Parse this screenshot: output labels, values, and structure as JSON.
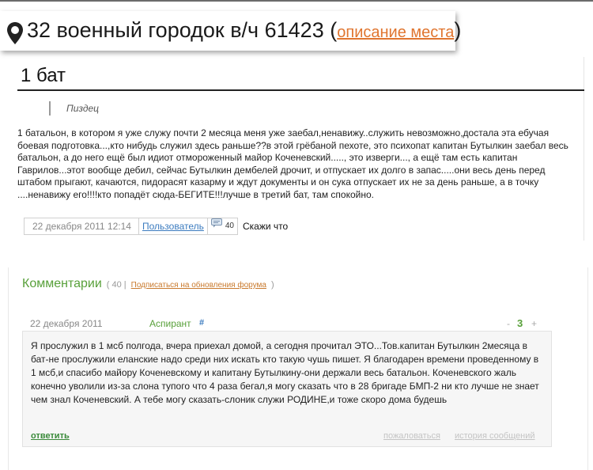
{
  "place": {
    "title": "32 военный городок в/ч 61423",
    "open_paren": "(",
    "link": "описание места",
    "close_paren": ")"
  },
  "post": {
    "title": "1 бат",
    "quote": "Пиздец",
    "body": "1 батальон, в котором я уже служу почти 2 месяца меня уже заебал,ненавижу..служить невозможно,достала эта ебучая боевая подготовка...,кто нибудь служил здесь раньше??в этой грёбаной пехоте, это психопат капитан Бутылкин заебал весь батальон, а до него ещё был идиот отмороженный майор Коченевский....., это изверги..., а ещё там есть капитан Гаврилов...этот вообще дебил, сейчас Бутылкин дембелей дрочит, и отпускает их долго в запас.....они весь день перед штабом прыгают, качаются, пидорасят казарму и ждут документы и он сука отпускает их не за день раньше, а в точку ....ненавижу его!!!!кто попадёт сюда-БЕГИТЕ!!!лучше в третий бат, там спокойно.",
    "date": "22 декабря 2011 12:14",
    "user": "Пользователь",
    "comment_count": "40",
    "say": "Скажи что"
  },
  "comments": {
    "title": "Комментарии",
    "count": "( 40 |",
    "subscribe": "Подписаться на обновления форума",
    "close": ")",
    "item": {
      "date": "22 декабря 2011",
      "author": "Аспирант",
      "hash": "#",
      "minus": "-",
      "score": "3",
      "plus": "+",
      "text": "Я прослужил в 1 мсб полгода, вчера приехал домой, а сегодня прочитал ЭТО...Тов.капитан Бутылкин 2месяца в бат-не прослужили еланские надо среди них искать кто такую чушь пишет. Я благодарен времени проведенному в 1 мсб,и спасибо майору Коченевскому и капитану Бутылкину-они держали весь батальон. Коченевского жаль конечно уволили из-за слона тупого что 4 раза бегал,я могу сказать что в 28 бригаде БМП-2 ни кто лучше не знает чем знал Коченевский. А тебе могу сказать-слоник служи РОДИНЕ,и тоже скоро дома будешь",
      "reply": "ответить",
      "report": "пожаловаться",
      "history": "история сообщений"
    }
  },
  "colors": {
    "accent_green": "#58a03a",
    "link_orange": "#e0752f",
    "link_blue": "#3b7bbf"
  },
  "icons": [
    "map-pin-icon",
    "comment-bubble-icon"
  ]
}
